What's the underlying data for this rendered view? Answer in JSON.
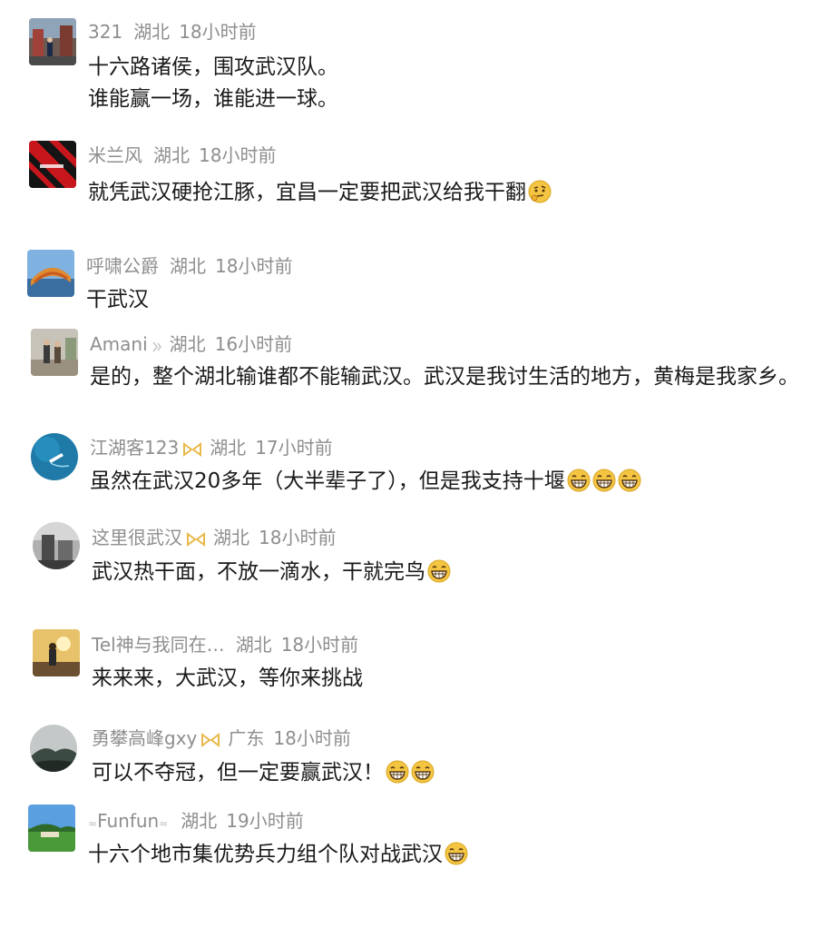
{
  "comments": [
    {
      "username": "321",
      "location": "湖北",
      "time": "18小时前",
      "lines": [
        "十六路诸侯，围攻武汉队。",
        "谁能赢一场，谁能进一球。"
      ],
      "avatar": "city-street-avatar"
    },
    {
      "username": "米兰风",
      "location": "湖北",
      "time": "18小时前",
      "lines": [
        "就凭武汉硬抢江豚，宜昌一定要把武汉给我干翻"
      ],
      "emoji": "thinking-face-emoji",
      "avatar": "ac-milan-jersey-avatar"
    },
    {
      "username": "呼啸公爵",
      "location": "湖北",
      "time": "18小时前",
      "lines": [
        "干武汉"
      ],
      "avatar": "stadium-avatar"
    },
    {
      "username": "Amani",
      "location": "湖北",
      "time": "16小时前",
      "lines": [
        "是的，整个湖北输谁都不能输武汉。武汉是我讨生活的地方，黄梅是我家乡。"
      ],
      "avatar": "people-walking-avatar"
    },
    {
      "username": "江湖客123",
      "location": "湖北",
      "time": "17小时前",
      "lines": [
        "虽然在武汉20多年（大半辈子了），但是我支持十堰"
      ],
      "emoji_count": 3,
      "avatar": "ocean-boat-avatar"
    },
    {
      "username": "这里很武汉",
      "location": "湖北",
      "time": "18小时前",
      "lines": [
        "武汉热干面，不放一滴水，干就完鸟"
      ],
      "emoji_count": 1,
      "avatar": "building-avatar"
    },
    {
      "username": "Tel神与我同在…",
      "location": "湖北",
      "time": "18小时前",
      "lines": [
        "来来来，大武汉，等你来挑战"
      ],
      "avatar": "sunset-person-avatar"
    },
    {
      "username": "勇攀高峰gxy",
      "location": "广东",
      "time": "18小时前",
      "lines": [
        "可以不夺冠，但一定要赢武汉！"
      ],
      "emoji_count": 2,
      "avatar": "foggy-mountain-avatar"
    },
    {
      "username": "Funfun",
      "location": "湖北",
      "time": "19小时前",
      "lines": [
        "十六个地市集优势兵力组个队对战武汉"
      ],
      "emoji_count": 1,
      "avatar": "landscape-avatar"
    }
  ],
  "colors": {
    "username": "#8e8e8e",
    "text": "#1a1a1a",
    "badge": "#e8b94a",
    "emoji": "#f4c542"
  }
}
